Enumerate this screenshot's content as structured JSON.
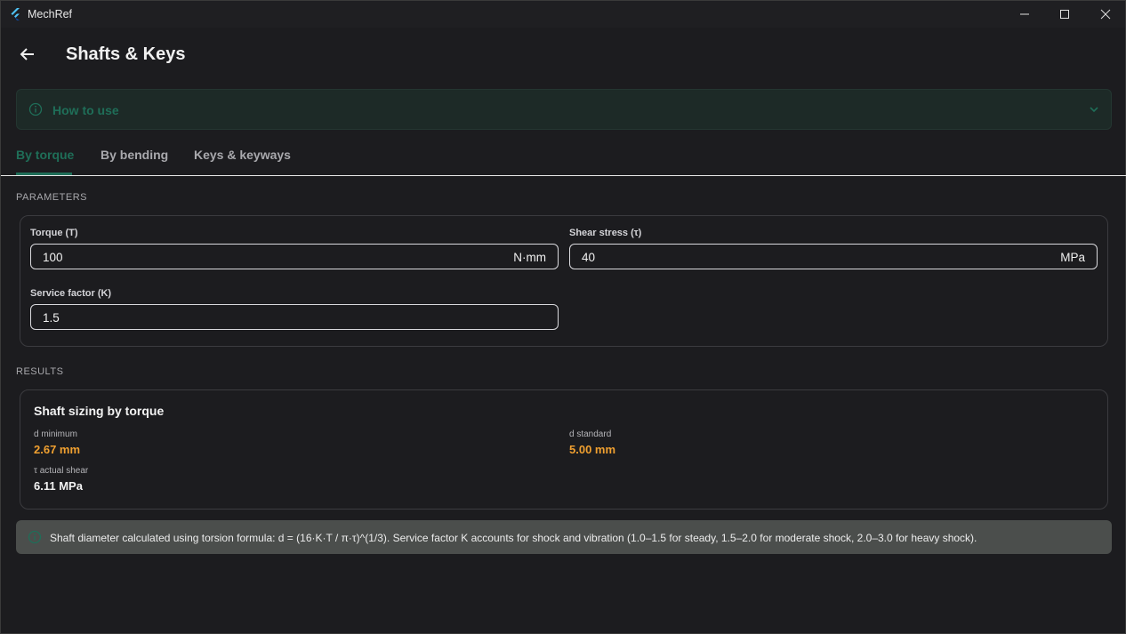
{
  "window": {
    "title": "MechRef"
  },
  "header": {
    "title": "Shafts & Keys"
  },
  "howto": {
    "label": "How to use"
  },
  "tabs": [
    {
      "label": "By torque",
      "active": true
    },
    {
      "label": "By bending",
      "active": false
    },
    {
      "label": "Keys & keyways",
      "active": false
    }
  ],
  "parameters": {
    "heading": "PARAMETERS",
    "torque": {
      "label": "Torque (T)",
      "value": "100",
      "unit": "N·mm"
    },
    "shear_stress": {
      "label": "Shear stress (τ)",
      "value": "40",
      "unit": "MPa"
    },
    "service_factor": {
      "label": "Service factor (K)",
      "value": "1.5"
    }
  },
  "results": {
    "heading": "RESULTS",
    "card_title": "Shaft sizing by torque",
    "d_minimum": {
      "label": "d minimum",
      "value": "2.67 mm"
    },
    "d_standard": {
      "label": "d standard",
      "value": "5.00 mm"
    },
    "actual_shear": {
      "label": "τ actual shear",
      "value": "6.11 MPa"
    }
  },
  "note": {
    "text": "Shaft diameter calculated using torsion formula: d = (16·K·T / π·τ)^(1/3). Service factor K accounts for shock and vibration (1.0–1.5 for steady, 1.5–2.0 for moderate shock, 2.0–3.0 for heavy shock)."
  },
  "colors": {
    "accent": "#1f6e58",
    "highlight": "#f0a030",
    "background": "#1c1c1f"
  }
}
